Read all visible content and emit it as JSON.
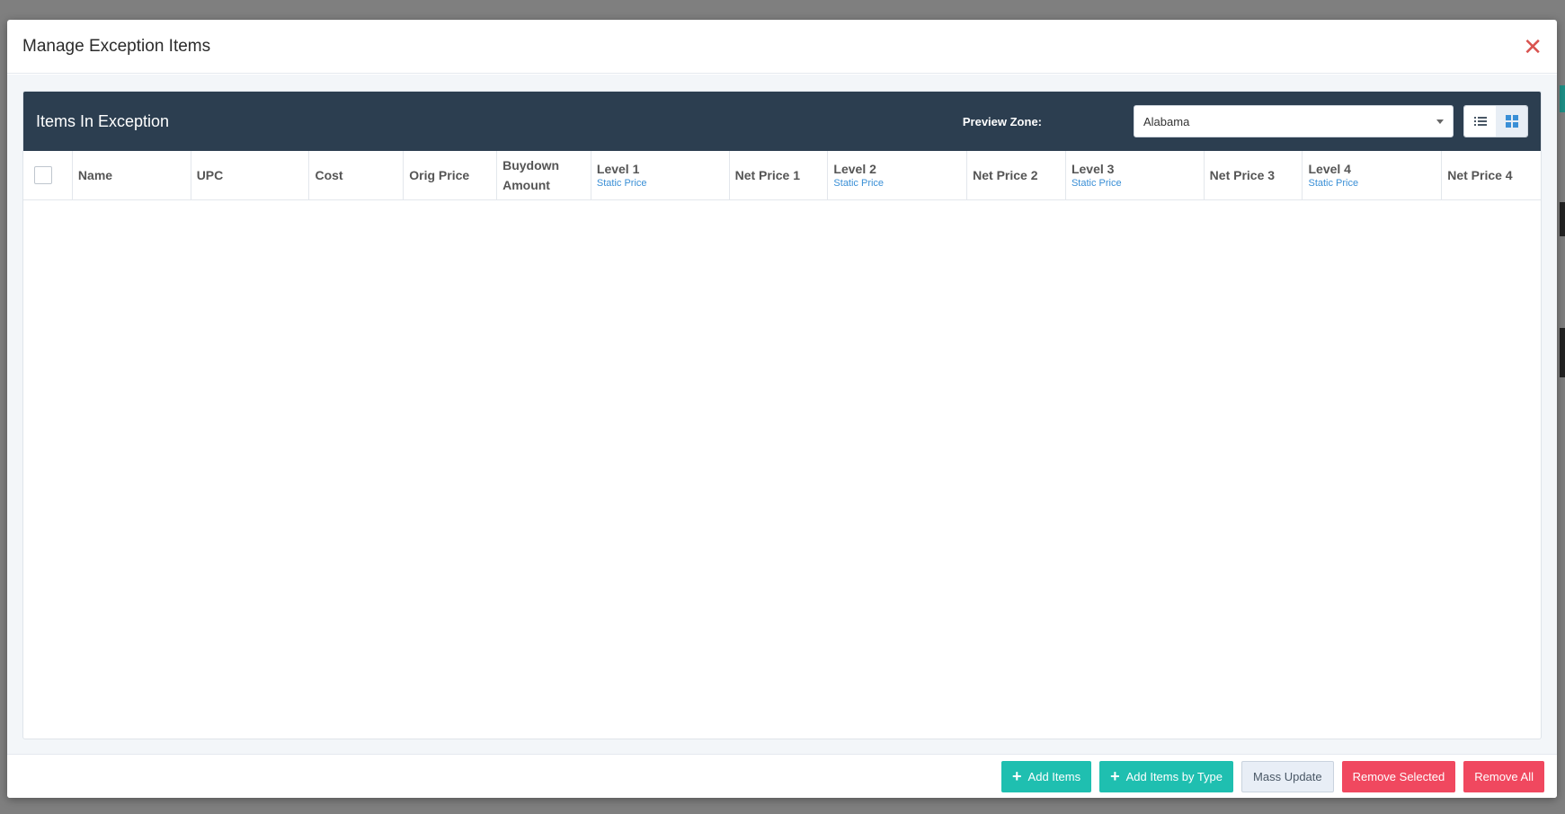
{
  "modal": {
    "title": "Manage Exception Items"
  },
  "panel": {
    "title": "Items In Exception",
    "zone_label": "Preview Zone:",
    "zone_value": "Alabama"
  },
  "table": {
    "columns": [
      {
        "label": "Name",
        "sub": ""
      },
      {
        "label": "UPC",
        "sub": ""
      },
      {
        "label": "Cost",
        "sub": ""
      },
      {
        "label": "Orig Price",
        "sub": ""
      },
      {
        "label": "Buydown Amount",
        "sub": ""
      },
      {
        "label": "Level 1",
        "sub": "Static Price"
      },
      {
        "label": "Net Price 1",
        "sub": ""
      },
      {
        "label": "Level 2",
        "sub": "Static Price"
      },
      {
        "label": "Net Price 2",
        "sub": ""
      },
      {
        "label": "Level 3",
        "sub": "Static Price"
      },
      {
        "label": "Net Price 3",
        "sub": ""
      },
      {
        "label": "Level 4",
        "sub": "Static Price"
      },
      {
        "label": "Net Price 4",
        "sub": ""
      }
    ]
  },
  "footer": {
    "add_items": "Add Items",
    "add_items_by_type": "Add Items by Type",
    "mass_update": "Mass Update",
    "remove_selected": "Remove Selected",
    "remove_all": "Remove All"
  },
  "colors": {
    "panel_header": "#2c3e50",
    "teal": "#1fbfb0",
    "red": "#f0485f",
    "link": "#3a8fd6"
  }
}
